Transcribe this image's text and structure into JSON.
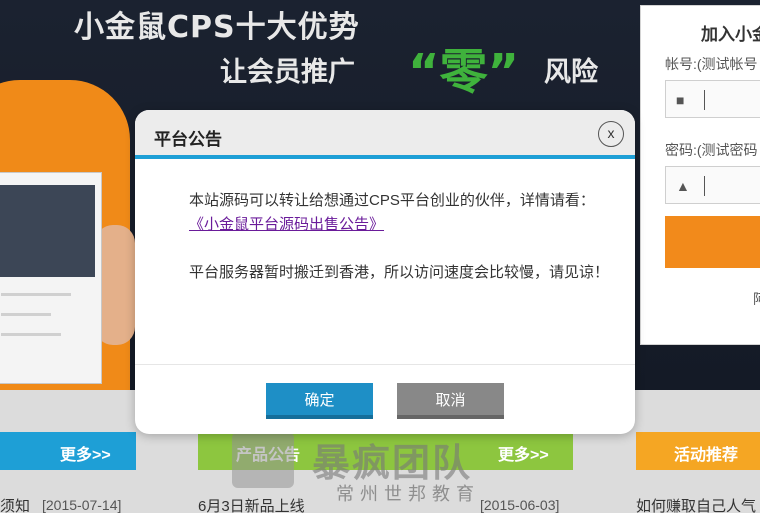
{
  "banner": {
    "title_line1": "小金鼠CPS十大优势",
    "title_line2": "让会员推广",
    "zero_text": "“零”",
    "risk_text": "风险"
  },
  "login": {
    "title": "加入小金",
    "account_label": "帐号:(测试帐号",
    "password_label": "密码:(测试密码",
    "misc_text": "阿"
  },
  "sections": {
    "left_more": "更多>>",
    "center_title": "产品公告",
    "center_more": "更多>>",
    "right_title": "活动推荐"
  },
  "news": {
    "left_title": "须知",
    "left_date": "[2015-07-14]",
    "center_title": "6月3日新品上线",
    "center_date": "[2015-06-03]",
    "right_title": "如何赚取自己人气"
  },
  "modal": {
    "title": "平台公告",
    "close_symbol": "x",
    "para1": "本站源码可以转让给想通过CPS平台创业的伙伴，详情请看：",
    "link_text": "《小金鼠平台源码出售公告》",
    "para2": "平台服务器暂时搬迁到香港，所以访问速度会比较慢，请见谅！",
    "ok_label": "确定",
    "cancel_label": "取消"
  },
  "watermark": {
    "main": "暴疯团队",
    "sub": "常州世邦教育"
  },
  "colors": {
    "accent_blue": "#1e9fd6",
    "button_ok": "#1e8fc6",
    "button_cancel": "#888888",
    "link": "#6a1b9a",
    "brand_orange": "#f28a1b",
    "green": "#3fb23c"
  }
}
